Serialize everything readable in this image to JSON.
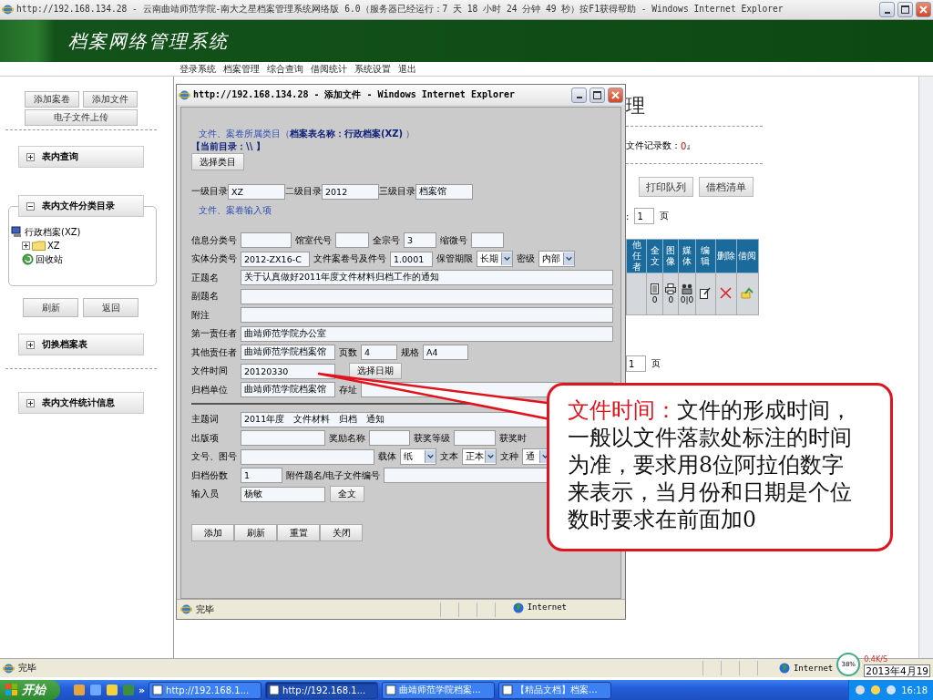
{
  "window": {
    "title": "http://192.168.134.28 - 云南曲靖师范学院-南大之星档案管理系统网络版 6.0（服务器已经运行：7 天 18 小时 24 分钟 49 秒）按F1获得帮助 - Windows Internet Explorer"
  },
  "header": {
    "title": "档案网络管理系统"
  },
  "menu": [
    "登录系统",
    "档案管理",
    "综合查询",
    "借阅统计",
    "系统设置",
    "退出"
  ],
  "sidebar": {
    "buttons": [
      "添加案卷",
      "添加文件",
      "电子文件上传"
    ],
    "panels": [
      {
        "title": "表内查询",
        "expanded": false
      },
      {
        "title": "表内文件分类目录",
        "expanded": true,
        "tree": [
          {
            "label": "行政档案(XZ)",
            "kind": "archive",
            "children": [
              {
                "label": "XZ",
                "kind": "folder",
                "expanded": false
              },
              {
                "label": "回收站",
                "kind": "recycle"
              }
            ]
          }
        ],
        "buttons": [
          "刷新",
          "返回"
        ]
      },
      {
        "title": "切换档案表",
        "expanded": false
      },
      {
        "title": "表内文件统计信息",
        "expanded": false
      }
    ]
  },
  "main": {
    "title": "理",
    "record_label": "文件记录数：",
    "record_count": "0",
    "record_suffix": "』",
    "buttons": [
      "打印队列",
      "借档清单"
    ],
    "pager_top": {
      "prefix": ":",
      "page": "1",
      "unit": "页"
    },
    "table": {
      "columns": [
        "他任者",
        "全文",
        "图像",
        "媒体",
        "编辑",
        "删除",
        "借阅"
      ],
      "counts": [
        "0",
        "0",
        "0|0"
      ]
    },
    "pager_bottom": {
      "page": "1",
      "unit": "页"
    }
  },
  "dialog": {
    "title": "http://192.168.134.28 - 添加文件 - Windows Internet Explorer",
    "category_heading": "文件、案卷所属类目（**档案表名称：行政档案(XZ)** ）",
    "current_dir": "【当前目录：\\\\ 】",
    "choose_button": "选择类目",
    "levels": [
      {
        "label": "一级目录",
        "value": "XZ"
      },
      {
        "label": "二级目录",
        "value": "2012"
      },
      {
        "label": "三级目录",
        "value": "档案馆"
      }
    ],
    "input_heading": "文件、案卷输入项",
    "form_lines": [
      {
        "items": [
          {
            "kind": "label",
            "text": "信息分类号"
          },
          {
            "kind": "field"
          },
          {
            "kind": "label",
            "text": "馆室代号"
          },
          {
            "kind": "field"
          },
          {
            "kind": "label",
            "text": "全宗号"
          },
          {
            "kind": "field",
            "value": "3"
          },
          {
            "kind": "label",
            "text": "缩微号"
          },
          {
            "kind": "field"
          }
        ]
      },
      {
        "items": [
          {
            "kind": "label",
            "text": "实体分类号"
          },
          {
            "kind": "field",
            "value": "2012-ZX16-C"
          },
          {
            "kind": "label",
            "text": "文件案卷号及件号"
          },
          {
            "kind": "field",
            "value": "1.0001"
          },
          {
            "kind": "label",
            "text": "保管期限"
          },
          {
            "kind": "select",
            "value": "长期"
          },
          {
            "kind": "label",
            "text": "密级"
          },
          {
            "kind": "select",
            "value": "内部"
          }
        ]
      },
      {
        "items": [
          {
            "kind": "label",
            "text": "正题名"
          },
          {
            "kind": "wide-field",
            "value": "关于认真做好2011年度文件材料归档工作的通知"
          }
        ]
      },
      {
        "items": [
          {
            "kind": "label",
            "text": "副题名"
          },
          {
            "kind": "wide-field"
          }
        ]
      },
      {
        "items": [
          {
            "kind": "label",
            "text": "附注"
          },
          {
            "kind": "wide-field"
          }
        ]
      },
      {
        "items": [
          {
            "kind": "label",
            "text": "第一责任者"
          },
          {
            "kind": "wide-field",
            "value": "曲靖师范学院办公室"
          }
        ]
      },
      {
        "items": [
          {
            "kind": "label",
            "text": "其他责任者"
          },
          {
            "kind": "field",
            "value": "曲靖师范学院档案馆"
          },
          {
            "kind": "label",
            "text": "页数"
          },
          {
            "kind": "field",
            "value": "4"
          },
          {
            "kind": "label",
            "text": "规格"
          },
          {
            "kind": "field",
            "value": "A4"
          }
        ]
      },
      {
        "items": [
          {
            "kind": "label",
            "text": "文件时间"
          },
          {
            "kind": "field",
            "value": "20120330"
          },
          {
            "kind": "button",
            "text": "选择日期"
          }
        ]
      },
      {
        "items": [
          {
            "kind": "label",
            "text": "归档单位"
          },
          {
            "kind": "field",
            "value": "曲靖师范学院档案馆"
          },
          {
            "kind": "label",
            "text": "存址"
          },
          {
            "kind": "wide-field"
          }
        ]
      }
    ],
    "form_lines_2": [
      {
        "items": [
          {
            "kind": "label",
            "text": "主题词"
          },
          {
            "kind": "wide-field",
            "value": "2011年度　文件材料　归档　通知"
          }
        ]
      },
      {
        "items": [
          {
            "kind": "label",
            "text": "出版项"
          },
          {
            "kind": "field"
          },
          {
            "kind": "label",
            "text": "奖励名称"
          },
          {
            "kind": "field"
          },
          {
            "kind": "label",
            "text": "获奖等级"
          },
          {
            "kind": "field"
          },
          {
            "kind": "label",
            "text": "获奖时"
          }
        ]
      },
      {
        "items": [
          {
            "kind": "label",
            "text": "文号、图号"
          },
          {
            "kind": "field"
          },
          {
            "kind": "label",
            "text": "载体"
          },
          {
            "kind": "select",
            "value": "纸"
          },
          {
            "kind": "label",
            "text": "文本"
          },
          {
            "kind": "select",
            "value": "正本"
          },
          {
            "kind": "label",
            "text": "文种"
          },
          {
            "kind": "select",
            "value": "通"
          }
        ]
      },
      {
        "items": [
          {
            "kind": "label",
            "text": "归档份数"
          },
          {
            "kind": "field",
            "value": "1"
          },
          {
            "kind": "label",
            "text": "附件题名/电子文件编号"
          },
          {
            "kind": "wide-field"
          }
        ]
      },
      {
        "items": [
          {
            "kind": "label",
            "text": "输入员"
          },
          {
            "kind": "field",
            "value": "杨敏"
          },
          {
            "kind": "button",
            "text": "全文"
          }
        ]
      }
    ],
    "buttons": [
      "添加",
      "刷新",
      "重置",
      "关闭"
    ],
    "status": "完毕",
    "zone": "Internet"
  },
  "annotation": {
    "term": "文件时间：",
    "text": "文件的形成时间，一般以文件落款处标注的时间为准，要求用8位阿拉伯数字来表示，当月份和日期是个位数时要求在前面加0"
  },
  "status_bar": {
    "text": "完毕",
    "zone": "Internet",
    "gauge": "38%",
    "speed": "0.4K/S",
    "date": "2013年4月19"
  },
  "taskbar": {
    "start": "开始",
    "more": "»",
    "tasks": [
      {
        "label": "http://192.168.1...",
        "selected": false
      },
      {
        "label": "http://192.168.1...",
        "selected": true
      },
      {
        "label": "曲靖师范学院档案...",
        "selected": false
      },
      {
        "label": "【精品文档】档案...",
        "selected": false
      }
    ],
    "clock": "16:18"
  }
}
